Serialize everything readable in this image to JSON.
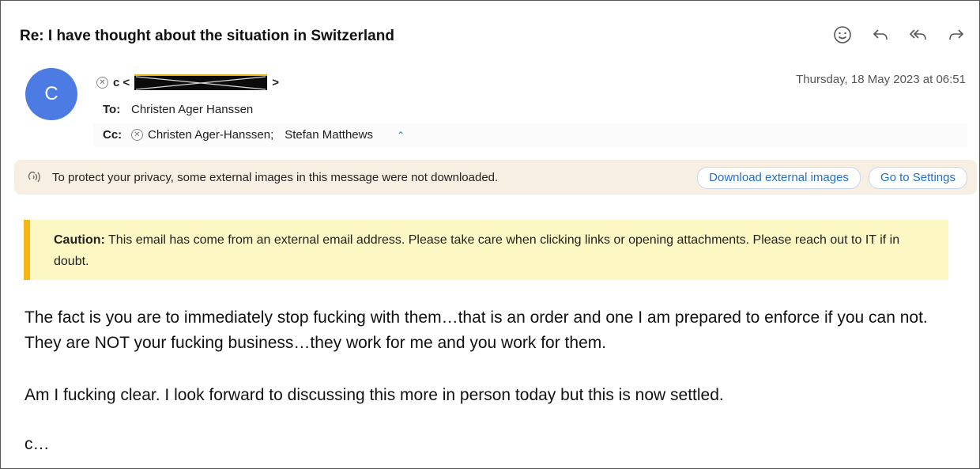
{
  "email": {
    "subject": "Re: I have thought about the situation in Switzerland",
    "sender_initial": "C",
    "sender_name": "c <",
    "sender_suffix": ">",
    "date": "Thursday, 18 May 2023 at 06:51",
    "to_label": "To:",
    "to_value": "Christen Ager Hanssen",
    "cc_label": "Cc:",
    "cc_first": "Christen Ager-Hanssen;",
    "cc_second": "Stefan Matthews"
  },
  "toolbar": {
    "icons": [
      "smiley-icon",
      "reply-icon",
      "reply-all-icon",
      "forward-icon"
    ]
  },
  "privacy": {
    "text": "To protect your privacy, some external images in this message were not downloaded.",
    "download_label": "Download external images",
    "settings_label": "Go to Settings"
  },
  "caution": {
    "label": "Caution:",
    "text": "This email has come from an external email address. Please take care when clicking links or opening attachments. Please reach out to IT if in doubt."
  },
  "body": {
    "paragraph_1": "The fact is you are to immediately stop fucking with them…that is an order and one I am prepared to enforce if you can not.  They are NOT your fucking business…they work for me and you work for them.",
    "paragraph_2": "Am I fucking clear.  I look forward to discussing this more in person today but this is now settled.",
    "signoff": "c…"
  },
  "colors": {
    "avatar": "#4c7be3",
    "caution_bg": "#fdf7c3",
    "caution_accent": "#f2b714",
    "link_blue": "#1f6fcf",
    "privacy_bg": "#f7f0e2"
  }
}
